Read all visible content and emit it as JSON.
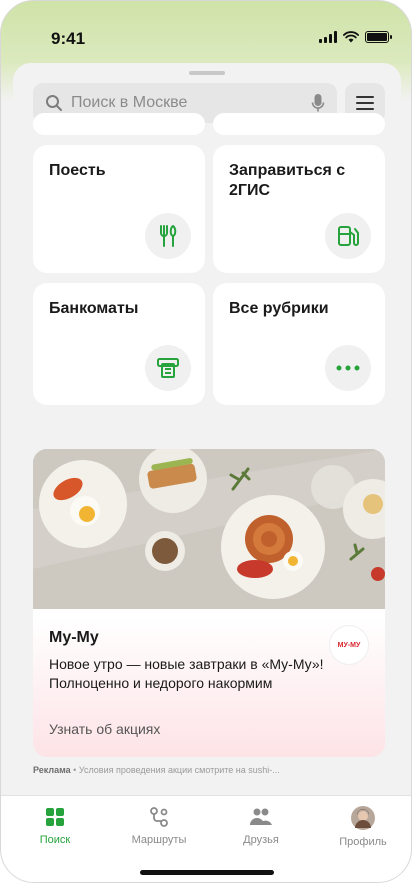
{
  "status_bar": {
    "time": "9:41"
  },
  "search": {
    "placeholder": "Поиск в Москве"
  },
  "tiles": [
    {
      "label": "Поесть",
      "icon": "fork-knife-icon"
    },
    {
      "label": "Заправиться с 2ГИС",
      "icon": "fuel-pump-icon"
    },
    {
      "label": "Банкоматы",
      "icon": "atm-icon"
    },
    {
      "label": "Все рубрики",
      "icon": "more-dots-icon"
    }
  ],
  "ad": {
    "title": "Му-Му",
    "text": "Новое утро — новые завтраки в «Му-Му»! Полноценно и недорого накормим",
    "link": "Узнать об акциях",
    "logo": "МУ-МУ",
    "disclaimer_label": "Реклама",
    "disclaimer_text": " • Условия проведения акции смотрите на sushi-..."
  },
  "tabbar": {
    "items": [
      {
        "label": "Поиск",
        "icon": "search-grid-icon",
        "active": true
      },
      {
        "label": "Маршруты",
        "icon": "route-icon",
        "active": false
      },
      {
        "label": "Друзья",
        "icon": "friends-icon",
        "active": false
      },
      {
        "label": "Профиль",
        "icon": "avatar",
        "active": false
      }
    ]
  },
  "colors": {
    "accent": "#26a33d",
    "header_green": "#cfe3a8",
    "ad_gradient": "#fde3e6"
  }
}
